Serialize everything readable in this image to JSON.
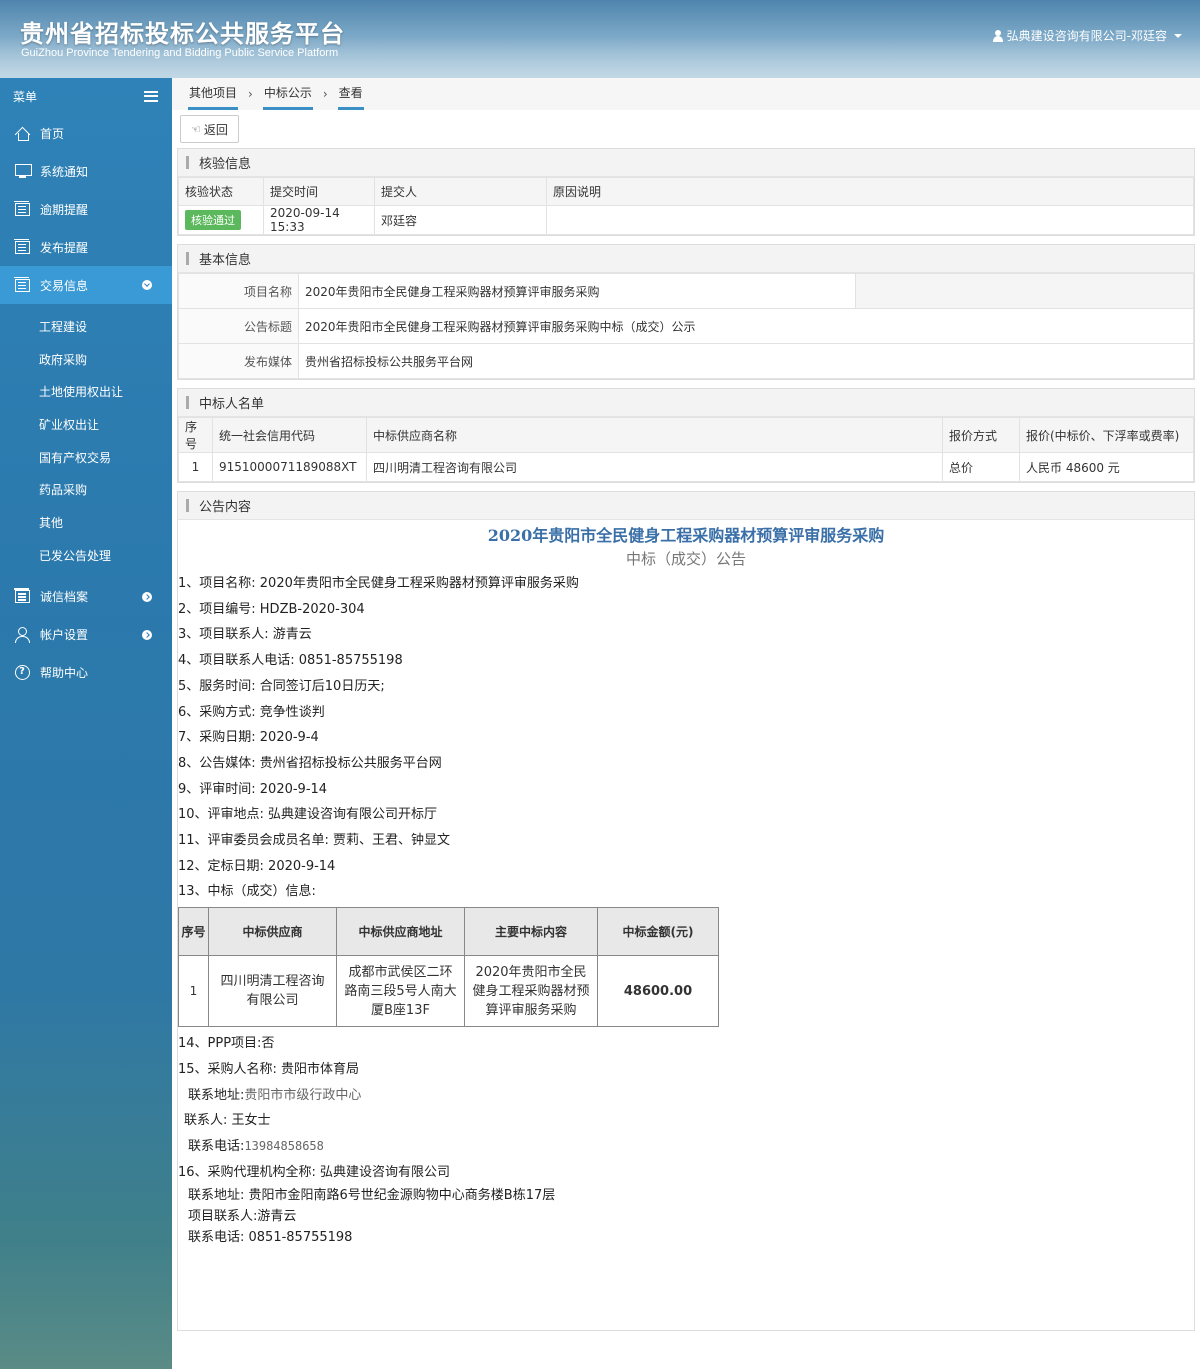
{
  "header": {
    "title": "贵州省招标投标公共服务平台",
    "subtitle": "GuiZhou Province Tendering and Bidding Public Service Platform",
    "user": "弘典建设咨询有限公司-邓廷容"
  },
  "sidebar": {
    "menu_label": "菜单",
    "items": [
      {
        "label": "首页",
        "icon": "home-icon"
      },
      {
        "label": "系统通知",
        "icon": "monitor-icon"
      },
      {
        "label": "逾期提醒",
        "icon": "list-icon"
      },
      {
        "label": "发布提醒",
        "icon": "list-icon"
      },
      {
        "label": "交易信息",
        "icon": "list-icon"
      },
      {
        "label": "诚信档案",
        "icon": "list-icon"
      },
      {
        "label": "帐户设置",
        "icon": "user-icon"
      },
      {
        "label": "帮助中心",
        "icon": "help-icon"
      }
    ],
    "sub_items": [
      "工程建设",
      "政府采购",
      "土地使用权出让",
      "矿业权出让",
      "国有产权交易",
      "药品采购",
      "其他",
      "已发公告处理"
    ]
  },
  "breadcrumb": [
    "其他项目",
    "中标公示",
    "查看"
  ],
  "toolbar": {
    "back_label": "返回"
  },
  "verify": {
    "title": "核验信息",
    "headers": [
      "核验状态",
      "提交时间",
      "提交人",
      "原因说明"
    ],
    "status": "核验通过",
    "time": "2020-09-14 15:33",
    "submitter": "邓廷容",
    "reason": ""
  },
  "basic": {
    "title": "基本信息",
    "project_name_label": "项目名称",
    "project_name": "2020年贵阳市全民健身工程采购器材预算评审服务采购",
    "notice_title_label": "公告标题",
    "notice_title": "2020年贵阳市全民健身工程采购器材预算评审服务采购中标（成交）公示",
    "media_label": "发布媒体",
    "media": "贵州省招标投标公共服务平台网"
  },
  "winners": {
    "title": "中标人名单",
    "headers": [
      "序号",
      "统一社会信用代码",
      "中标供应商名称",
      "报价方式",
      "报价(中标价、下浮率或费率)"
    ],
    "rows": [
      [
        "1",
        "9151000071189088XT",
        "四川明清工程咨询有限公司",
        "总价",
        "人民币 48600 元"
      ]
    ]
  },
  "announcement": {
    "title": "公告内容",
    "heading": "2020年贵阳市全民健身工程采购器材预算评审服务采购",
    "subheading": "中标（成交）公告",
    "lines": [
      "1、项目名称: 2020年贵阳市全民健身工程采购器材预算评审服务采购",
      "2、项目编号: HDZB-2020-304",
      "3、项目联系人: 游青云",
      "4、项目联系人电话: 0851-85755198",
      "5、服务时间: 合同签订后10日历天;",
      "6、采购方式: 竞争性谈判",
      "7、采购日期: 2020-9-4",
      "8、公告媒体: 贵州省招标投标公共服务平台网",
      "9、评审时间: 2020-9-14",
      "10、评审地点: 弘典建设咨询有限公司开标厅",
      "11、评审委员会成员名单: 贾莉、王君、钟显文",
      "12、定标日期:  2020-9-14",
      "13、中标（成交）信息:"
    ],
    "award_headers": [
      "序号",
      "中标供应商",
      "中标供应商地址",
      "主要中标内容",
      "中标金额(元)"
    ],
    "award_row": [
      "1",
      "四川明清工程咨询有限公司",
      "成都市武侯区二环路南三段5号人南大厦B座13F",
      "2020年贵阳市全民健身工程采购器材预算评审服务采购",
      "48600.00"
    ],
    "tail": {
      "ppp": "14、PPP项目:否",
      "buyer": "15、采购人名称: 贵阳市体育局",
      "buyer_addr_label": "联系地址:",
      "buyer_addr": "贵阳市市级行政中心",
      "buyer_contact": "联系人: 王女士",
      "buyer_phone_label": "联系电话:",
      "buyer_phone": "13984858658",
      "agent": "16、采购代理机构全称: 弘典建设咨询有限公司",
      "agent_addr": "联系地址: 贵阳市金阳南路6号世纪金源购物中心商务楼B栋17层",
      "agent_contact": "项目联系人:游青云",
      "agent_phone": "联系电话: 0851-85755198"
    }
  }
}
